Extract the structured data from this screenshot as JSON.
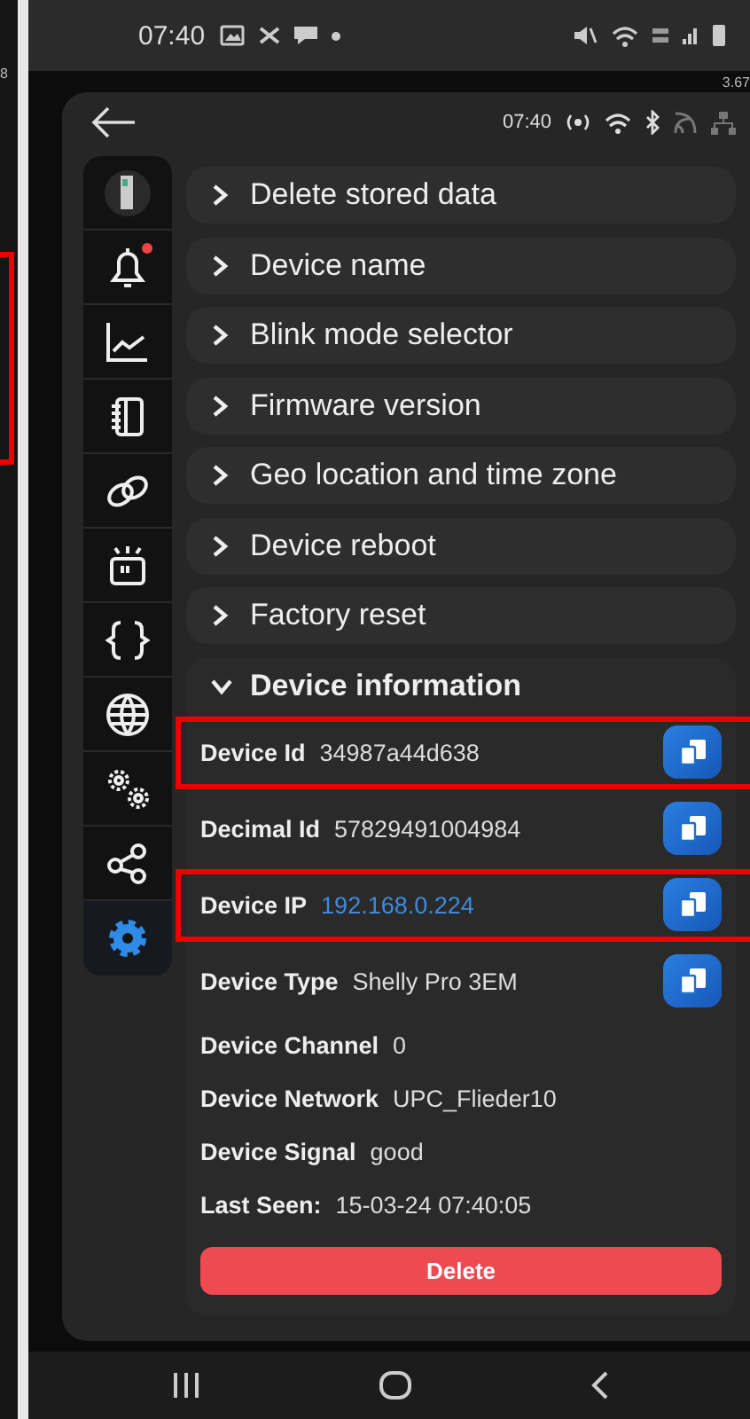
{
  "left_fragment": {
    "text": "8",
    "highlighted": true
  },
  "status_bar": {
    "time": "07:40"
  },
  "background_fragment": "3.67",
  "app_header": {
    "time": "07:40"
  },
  "sidebar": {
    "items": [
      {
        "kind": "device",
        "selected": false,
        "badge": false
      },
      {
        "kind": "bell",
        "selected": false,
        "badge": true
      },
      {
        "kind": "chart",
        "selected": false,
        "badge": false
      },
      {
        "kind": "notebook",
        "selected": false,
        "badge": false
      },
      {
        "kind": "link",
        "selected": false,
        "badge": false
      },
      {
        "kind": "blink",
        "selected": false,
        "badge": false
      },
      {
        "kind": "braces",
        "selected": false,
        "badge": false
      },
      {
        "kind": "globe",
        "selected": false,
        "badge": false
      },
      {
        "kind": "gears",
        "selected": false,
        "badge": false
      },
      {
        "kind": "share",
        "selected": false,
        "badge": false
      },
      {
        "kind": "gear",
        "selected": true,
        "badge": false
      }
    ]
  },
  "sections": [
    {
      "title": "Delete stored data",
      "expanded": false
    },
    {
      "title": "Device name",
      "expanded": false
    },
    {
      "title": "Blink mode selector",
      "expanded": false
    },
    {
      "title": "Firmware version",
      "expanded": false
    },
    {
      "title": "Geo location and time zone",
      "expanded": false
    },
    {
      "title": "Device reboot",
      "expanded": false
    },
    {
      "title": "Factory reset",
      "expanded": false
    },
    {
      "title": "Device information",
      "expanded": true
    }
  ],
  "device_information": {
    "rows": [
      {
        "label": "Device Id",
        "value": "34987a44d638",
        "kind": "text",
        "copy": true,
        "highlighted": true
      },
      {
        "label": "Decimal Id",
        "value": "57829491004984",
        "kind": "text",
        "copy": true,
        "highlighted": false
      },
      {
        "label": "Device IP",
        "value": "192.168.0.224",
        "kind": "link",
        "copy": true,
        "highlighted": true
      },
      {
        "label": "Device Type",
        "value": "Shelly Pro 3EM",
        "kind": "text",
        "copy": true,
        "highlighted": false
      },
      {
        "label": "Device Channel",
        "value": "0",
        "kind": "text",
        "copy": false,
        "highlighted": false
      },
      {
        "label": "Device Network",
        "value": "UPC_Flieder10",
        "kind": "text",
        "copy": false,
        "highlighted": false
      },
      {
        "label": "Device Signal",
        "value": "good",
        "kind": "text",
        "copy": false,
        "highlighted": false
      },
      {
        "label": "Last Seen:",
        "value": "15-03-24 07:40:05",
        "kind": "text",
        "copy": false,
        "highlighted": false
      }
    ],
    "delete_button": "Delete"
  }
}
